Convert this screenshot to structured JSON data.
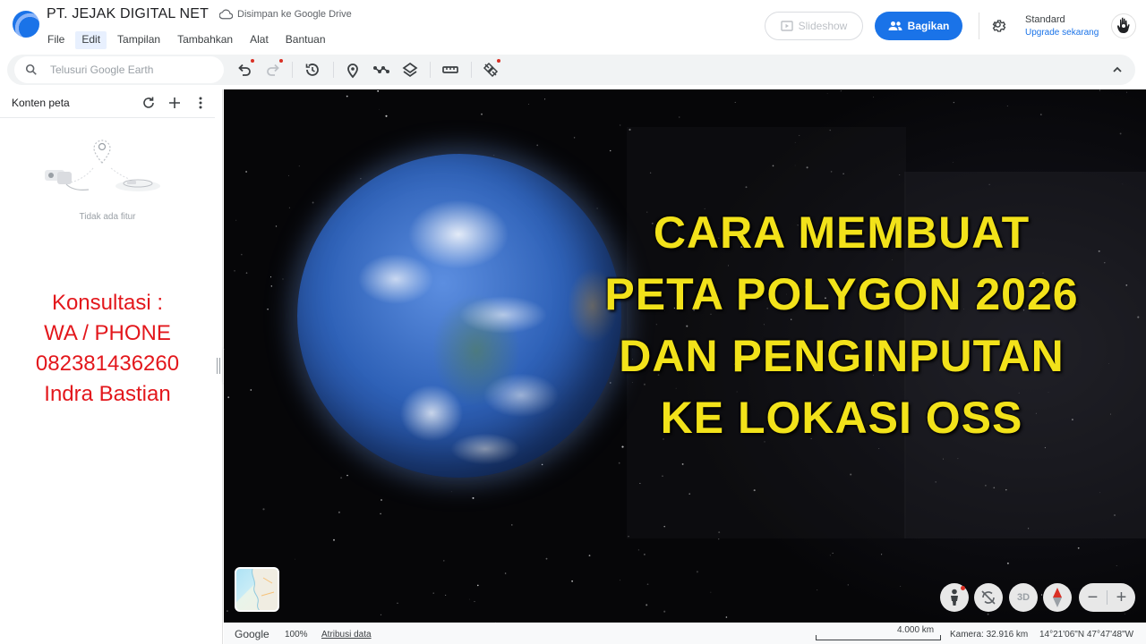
{
  "header": {
    "doc_title": "PT. JEJAK DIGITAL NET",
    "save_status": "Disimpan ke Google Drive",
    "menu": [
      "File",
      "Edit",
      "Tampilan",
      "Tambahkan",
      "Alat",
      "Bantuan"
    ],
    "active_menu": "Edit",
    "slideshow_label": "Slideshow",
    "share_label": "Bagikan",
    "plan_label": "Standard",
    "upgrade_label": "Upgrade sekarang"
  },
  "search": {
    "placeholder": "Telusuri Google Earth",
    "value": ""
  },
  "toolbar": {
    "tools": [
      "undo-icon",
      "redo-icon",
      "history-icon",
      "placemark-icon",
      "path-icon",
      "layers-icon",
      "ruler-icon",
      "satellite-icon",
      "collapse-icon"
    ]
  },
  "sidebar": {
    "title": "Konten peta",
    "empty_text": "Tidak ada fitur",
    "consult_lines": [
      "Konsultasi :",
      "WA / PHONE",
      "082381436260",
      "Indra Bastian"
    ]
  },
  "map": {
    "headline_lines": [
      "CARA MEMBUAT",
      "PETA POLYGON 2026",
      "DAN PENGINPUTAN",
      "KE LOKASI OSS"
    ],
    "three_d_label": "3D",
    "zoom_out": "−",
    "zoom_in": "+"
  },
  "statusbar": {
    "brand": "Google",
    "zoom": "100%",
    "attribution": "Atribusi data",
    "scale": "4.000 km",
    "camera": "Kamera: 32.916 km",
    "coords": "14°21'06\"N 47°47'48\"W"
  },
  "colors": {
    "accent": "#1a73e8",
    "headline": "#f2e21a",
    "consult_text": "#e3171c"
  }
}
